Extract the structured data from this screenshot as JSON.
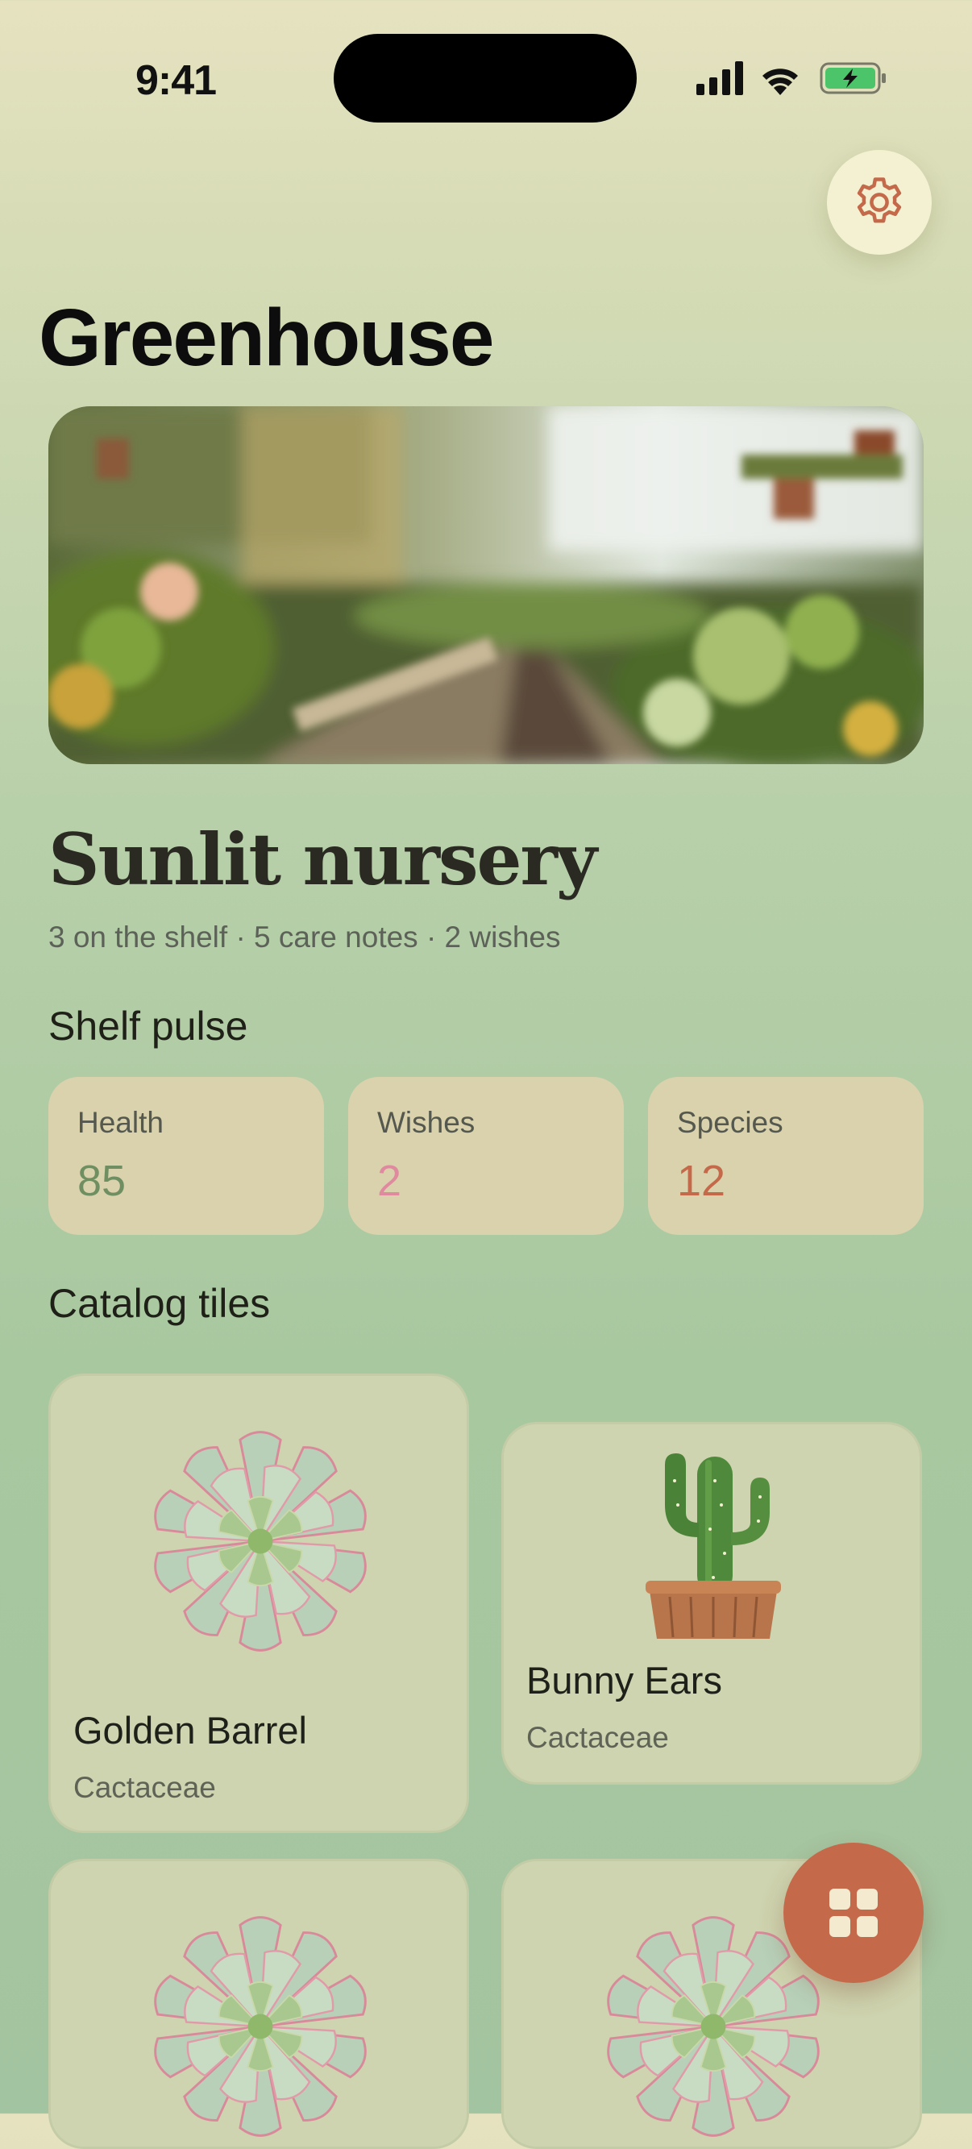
{
  "status": {
    "time": "9:41"
  },
  "header": {
    "title": "Greenhouse"
  },
  "nursery": {
    "name": "Sunlit nursery",
    "summary": "3 on the shelf · 5 care notes · 2 wishes"
  },
  "pulse": {
    "heading": "Shelf pulse",
    "stats": [
      {
        "label": "Health",
        "value": "85",
        "color": "#6f8f62"
      },
      {
        "label": "Wishes",
        "value": "2",
        "color": "#e08aa0"
      },
      {
        "label": "Species",
        "value": "12",
        "color": "#c4694a"
      }
    ]
  },
  "catalog": {
    "heading": "Catalog tiles",
    "tiles": [
      {
        "name": "Golden Barrel",
        "family": "Cactaceae",
        "icon": "succulent-rosette-icon"
      },
      {
        "name": "Bunny Ears",
        "family": "Cactaceae",
        "icon": "potted-cactus-icon"
      },
      {
        "name": "",
        "family": "",
        "icon": "succulent-rosette-icon"
      },
      {
        "name": "",
        "family": "",
        "icon": "succulent-rosette-icon"
      }
    ]
  },
  "colors": {
    "accent": "#c4694a",
    "card": "#d9d2ac",
    "tile": "#ced4af"
  },
  "icons": {
    "settings": "gear-icon",
    "fab": "grid-icon"
  }
}
